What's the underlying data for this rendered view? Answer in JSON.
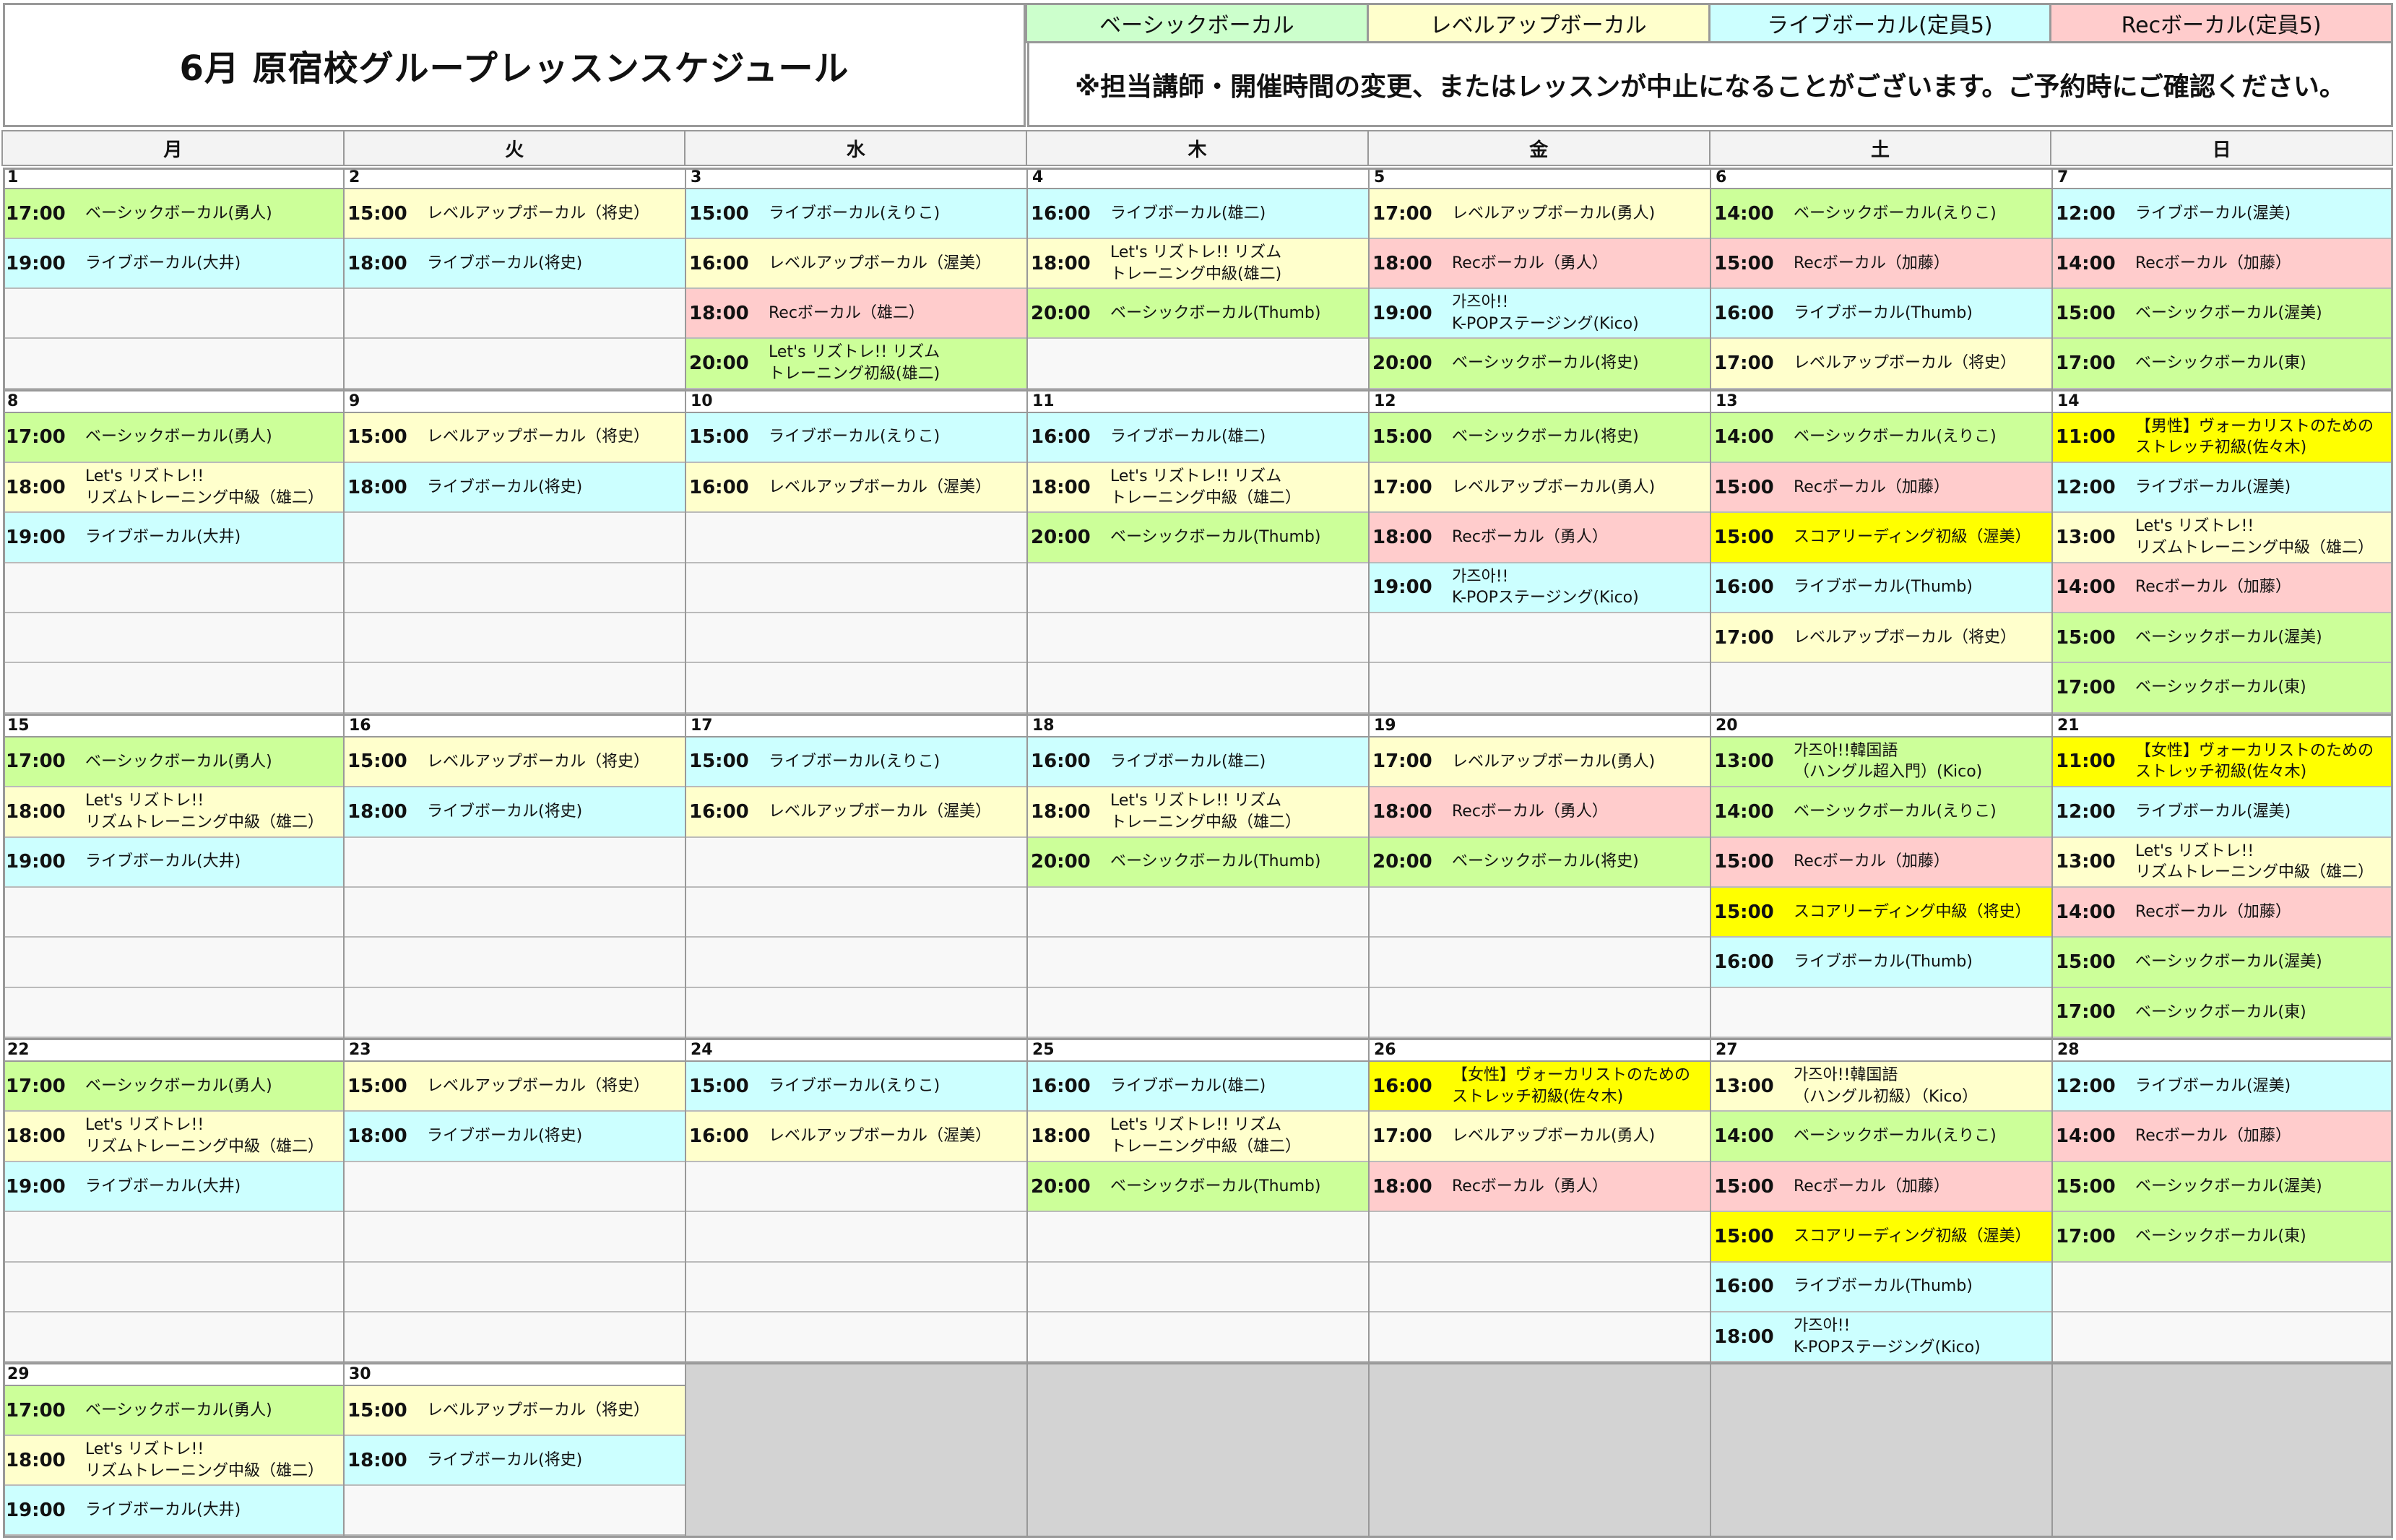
{
  "header": {
    "title": "6月 原宿校グループレッスンスケジュール",
    "notice": "※担当講師・開催時間の変更、またはレッスンが中止になることがございます。ご予約時にご確認ください。"
  },
  "legend": [
    {
      "label": "ベーシックボーカル",
      "color": "#ccffcc"
    },
    {
      "label": "レベルアップボーカル",
      "color": "#ffffcc"
    },
    {
      "label": "ライブボーカル(定員5)",
      "color": "#ccffff"
    },
    {
      "label": "Recボーカル(定員5)",
      "color": "#ffcccc"
    }
  ],
  "colors": {
    "basic": "#ccff99",
    "levelup": "#ffffcc",
    "live": "#ccffff",
    "rec": "#ffcccc",
    "special": "#ffff00",
    "empty": "#f8f8f8",
    "grey": "#d3d3d3"
  },
  "weekdays": [
    "月",
    "火",
    "水",
    "木",
    "金",
    "土",
    "日"
  ],
  "weeks": [
    {
      "slots": 4,
      "days": [
        {
          "date": "1",
          "lessons": [
            {
              "time": "17:00",
              "label": "ベーシックボーカル(勇人)",
              "type": "basic"
            },
            {
              "time": "19:00",
              "label": "ライブボーカル(大井)",
              "type": "live"
            }
          ]
        },
        {
          "date": "2",
          "lessons": [
            {
              "time": "15:00",
              "label": "レベルアップボーカル（将史）",
              "type": "levelup"
            },
            {
              "time": "18:00",
              "label": "ライブボーカル(将史)",
              "type": "live"
            }
          ]
        },
        {
          "date": "3",
          "lessons": [
            {
              "time": "15:00",
              "label": "ライブボーカル(えりこ)",
              "type": "live"
            },
            {
              "time": "16:00",
              "label": "レベルアップボーカル（渥美）",
              "type": "levelup"
            },
            {
              "time": "18:00",
              "label": "Recボーカル（雄二）",
              "type": "rec"
            },
            {
              "time": "20:00",
              "label": "Let's リズトレ!! リズム\nトレーニング初級(雄二)",
              "type": "basic"
            }
          ]
        },
        {
          "date": "4",
          "lessons": [
            {
              "time": "16:00",
              "label": "ライブボーカル(雄二)",
              "type": "live"
            },
            {
              "time": "18:00",
              "label": "Let's リズトレ!! リズム\nトレーニング中級(雄二)",
              "type": "levelup"
            },
            {
              "time": "20:00",
              "label": "ベーシックボーカル(Thumb)",
              "type": "basic"
            }
          ]
        },
        {
          "date": "5",
          "lessons": [
            {
              "time": "17:00",
              "label": "レベルアップボーカル(勇人)",
              "type": "levelup"
            },
            {
              "time": "18:00",
              "label": "Recボーカル（勇人）",
              "type": "rec"
            },
            {
              "time": "19:00",
              "label": "가즈아!!\nK-POPステージング(Kico)",
              "type": "live"
            },
            {
              "time": "20:00",
              "label": "ベーシックボーカル(将史)",
              "type": "basic"
            }
          ]
        },
        {
          "date": "6",
          "lessons": [
            {
              "time": "14:00",
              "label": "ベーシックボーカル(えりこ)",
              "type": "basic"
            },
            {
              "time": "15:00",
              "label": "Recボーカル（加藤）",
              "type": "rec"
            },
            {
              "time": "16:00",
              "label": "ライブボーカル(Thumb)",
              "type": "live"
            },
            {
              "time": "17:00",
              "label": "レベルアップボーカル（将史）",
              "type": "levelup"
            }
          ]
        },
        {
          "date": "7",
          "lessons": [
            {
              "time": "12:00",
              "label": "ライブボーカル(渥美)",
              "type": "live"
            },
            {
              "time": "14:00",
              "label": "Recボーカル（加藤）",
              "type": "rec"
            },
            {
              "time": "15:00",
              "label": "ベーシックボーカル(渥美)",
              "type": "basic"
            },
            {
              "time": "17:00",
              "label": "ベーシックボーカル(東)",
              "type": "basic"
            }
          ]
        }
      ]
    },
    {
      "slots": 6,
      "days": [
        {
          "date": "8",
          "lessons": [
            {
              "time": "17:00",
              "label": "ベーシックボーカル(勇人)",
              "type": "basic"
            },
            {
              "time": "18:00",
              "label": "Let's リズトレ!!\nリズムトレーニング中級（雄二）",
              "type": "levelup"
            },
            {
              "time": "19:00",
              "label": "ライブボーカル(大井)",
              "type": "live"
            }
          ]
        },
        {
          "date": "9",
          "lessons": [
            {
              "time": "15:00",
              "label": "レベルアップボーカル（将史）",
              "type": "levelup"
            },
            {
              "time": "18:00",
              "label": "ライブボーカル(将史)",
              "type": "live"
            }
          ]
        },
        {
          "date": "10",
          "lessons": [
            {
              "time": "15:00",
              "label": "ライブボーカル(えりこ)",
              "type": "live"
            },
            {
              "time": "16:00",
              "label": "レベルアップボーカル（渥美）",
              "type": "levelup"
            }
          ]
        },
        {
          "date": "11",
          "lessons": [
            {
              "time": "16:00",
              "label": "ライブボーカル(雄二)",
              "type": "live"
            },
            {
              "time": "18:00",
              "label": "Let's リズトレ!! リズム\nトレーニング中級（雄二）",
              "type": "levelup"
            },
            {
              "time": "20:00",
              "label": "ベーシックボーカル(Thumb)",
              "type": "basic"
            }
          ]
        },
        {
          "date": "12",
          "lessons": [
            {
              "time": "15:00",
              "label": "ベーシックボーカル(将史)",
              "type": "basic"
            },
            {
              "time": "17:00",
              "label": "レベルアップボーカル(勇人)",
              "type": "levelup"
            },
            {
              "time": "18:00",
              "label": "Recボーカル（勇人）",
              "type": "rec"
            },
            {
              "time": "19:00",
              "label": "가즈아!!\nK-POPステージング(Kico)",
              "type": "live"
            }
          ]
        },
        {
          "date": "13",
          "lessons": [
            {
              "time": "14:00",
              "label": "ベーシックボーカル(えりこ)",
              "type": "basic"
            },
            {
              "time": "15:00",
              "label": "Recボーカル（加藤）",
              "type": "rec"
            },
            {
              "time": "15:00",
              "label": "スコアリーディング初級（渥美）",
              "type": "special"
            },
            {
              "time": "16:00",
              "label": "ライブボーカル(Thumb)",
              "type": "live"
            },
            {
              "time": "17:00",
              "label": "レベルアップボーカル（将史）",
              "type": "levelup"
            }
          ]
        },
        {
          "date": "14",
          "lessons": [
            {
              "time": "11:00",
              "label": "【男性】ヴォーカリストのための\nストレッチ初級(佐々木)",
              "type": "special"
            },
            {
              "time": "12:00",
              "label": "ライブボーカル(渥美)",
              "type": "live"
            },
            {
              "time": "13:00",
              "label": "Let's リズトレ!!\nリズムトレーニング中級（雄二）",
              "type": "levelup"
            },
            {
              "time": "14:00",
              "label": "Recボーカル（加藤）",
              "type": "rec"
            },
            {
              "time": "15:00",
              "label": "ベーシックボーカル(渥美)",
              "type": "basic"
            },
            {
              "time": "17:00",
              "label": "ベーシックボーカル(東)",
              "type": "basic"
            }
          ]
        }
      ]
    },
    {
      "slots": 6,
      "days": [
        {
          "date": "15",
          "lessons": [
            {
              "time": "17:00",
              "label": "ベーシックボーカル(勇人)",
              "type": "basic"
            },
            {
              "time": "18:00",
              "label": "Let's リズトレ!!\nリズムトレーニング中級（雄二）",
              "type": "levelup"
            },
            {
              "time": "19:00",
              "label": "ライブボーカル(大井)",
              "type": "live"
            }
          ]
        },
        {
          "date": "16",
          "lessons": [
            {
              "time": "15:00",
              "label": "レベルアップボーカル（将史）",
              "type": "levelup"
            },
            {
              "time": "18:00",
              "label": "ライブボーカル(将史)",
              "type": "live"
            }
          ]
        },
        {
          "date": "17",
          "lessons": [
            {
              "time": "15:00",
              "label": "ライブボーカル(えりこ)",
              "type": "live"
            },
            {
              "time": "16:00",
              "label": "レベルアップボーカル（渥美）",
              "type": "levelup"
            }
          ]
        },
        {
          "date": "18",
          "lessons": [
            {
              "time": "16:00",
              "label": "ライブボーカル(雄二)",
              "type": "live"
            },
            {
              "time": "18:00",
              "label": "Let's リズトレ!! リズム\nトレーニング中級（雄二）",
              "type": "levelup"
            },
            {
              "time": "20:00",
              "label": "ベーシックボーカル(Thumb)",
              "type": "basic"
            }
          ]
        },
        {
          "date": "19",
          "lessons": [
            {
              "time": "17:00",
              "label": "レベルアップボーカル(勇人)",
              "type": "levelup"
            },
            {
              "time": "18:00",
              "label": "Recボーカル（勇人）",
              "type": "rec"
            },
            {
              "time": "20:00",
              "label": "ベーシックボーカル(将史)",
              "type": "basic"
            }
          ]
        },
        {
          "date": "20",
          "lessons": [
            {
              "time": "13:00",
              "label": "가즈아!!韓国語\n（ハングル超入門）(Kico)",
              "type": "basic"
            },
            {
              "time": "14:00",
              "label": "ベーシックボーカル(えりこ)",
              "type": "basic"
            },
            {
              "time": "15:00",
              "label": "Recボーカル（加藤）",
              "type": "rec"
            },
            {
              "time": "15:00",
              "label": "スコアリーディング中級（将史）",
              "type": "special"
            },
            {
              "time": "16:00",
              "label": "ライブボーカル(Thumb)",
              "type": "live"
            }
          ]
        },
        {
          "date": "21",
          "lessons": [
            {
              "time": "11:00",
              "label": "【女性】ヴォーカリストのための\nストレッチ初級(佐々木)",
              "type": "special"
            },
            {
              "time": "12:00",
              "label": "ライブボーカル(渥美)",
              "type": "live"
            },
            {
              "time": "13:00",
              "label": "Let's リズトレ!!\nリズムトレーニング中級（雄二）",
              "type": "levelup"
            },
            {
              "time": "14:00",
              "label": "Recボーカル（加藤）",
              "type": "rec"
            },
            {
              "time": "15:00",
              "label": "ベーシックボーカル(渥美)",
              "type": "basic"
            },
            {
              "time": "17:00",
              "label": "ベーシックボーカル(東)",
              "type": "basic"
            }
          ]
        }
      ]
    },
    {
      "slots": 6,
      "days": [
        {
          "date": "22",
          "lessons": [
            {
              "time": "17:00",
              "label": "ベーシックボーカル(勇人)",
              "type": "basic"
            },
            {
              "time": "18:00",
              "label": "Let's リズトレ!!\nリズムトレーニング中級（雄二）",
              "type": "levelup"
            },
            {
              "time": "19:00",
              "label": "ライブボーカル(大井)",
              "type": "live"
            }
          ]
        },
        {
          "date": "23",
          "lessons": [
            {
              "time": "15:00",
              "label": "レベルアップボーカル（将史）",
              "type": "levelup"
            },
            {
              "time": "18:00",
              "label": "ライブボーカル(将史)",
              "type": "live"
            }
          ]
        },
        {
          "date": "24",
          "lessons": [
            {
              "time": "15:00",
              "label": "ライブボーカル(えりこ)",
              "type": "live"
            },
            {
              "time": "16:00",
              "label": "レベルアップボーカル（渥美）",
              "type": "levelup"
            }
          ]
        },
        {
          "date": "25",
          "lessons": [
            {
              "time": "16:00",
              "label": "ライブボーカル(雄二)",
              "type": "live"
            },
            {
              "time": "18:00",
              "label": "Let's リズトレ!! リズム\nトレーニング中級（雄二）",
              "type": "levelup"
            },
            {
              "time": "20:00",
              "label": "ベーシックボーカル(Thumb)",
              "type": "basic"
            }
          ]
        },
        {
          "date": "26",
          "lessons": [
            {
              "time": "16:00",
              "label": "【女性】ヴォーカリストのための\nストレッチ初級(佐々木)",
              "type": "special"
            },
            {
              "time": "17:00",
              "label": "レベルアップボーカル(勇人)",
              "type": "levelup"
            },
            {
              "time": "18:00",
              "label": "Recボーカル（勇人）",
              "type": "rec"
            }
          ]
        },
        {
          "date": "27",
          "lessons": [
            {
              "time": "13:00",
              "label": "가즈아!!韓国語\n（ハングル初級）（Kico）",
              "type": "levelup"
            },
            {
              "time": "14:00",
              "label": "ベーシックボーカル(えりこ)",
              "type": "basic"
            },
            {
              "time": "15:00",
              "label": "Recボーカル（加藤）",
              "type": "rec"
            },
            {
              "time": "15:00",
              "label": "スコアリーディング初級（渥美）",
              "type": "special"
            },
            {
              "time": "16:00",
              "label": "ライブボーカル(Thumb)",
              "type": "live"
            },
            {
              "time": "18:00",
              "label": "가즈아!!\nK-POPステージング(Kico)",
              "type": "live"
            }
          ]
        },
        {
          "date": "28",
          "lessons": [
            {
              "time": "12:00",
              "label": "ライブボーカル(渥美)",
              "type": "live"
            },
            {
              "time": "14:00",
              "label": "Recボーカル（加藤）",
              "type": "rec"
            },
            {
              "time": "15:00",
              "label": "ベーシックボーカル(渥美)",
              "type": "basic"
            },
            {
              "time": "17:00",
              "label": "ベーシックボーカル(東)",
              "type": "basic"
            }
          ]
        }
      ]
    },
    {
      "slots": 3,
      "days": [
        {
          "date": "29",
          "lessons": [
            {
              "time": "17:00",
              "label": "ベーシックボーカル(勇人)",
              "type": "basic"
            },
            {
              "time": "18:00",
              "label": "Let's リズトレ!!\nリズムトレーニング中級（雄二）",
              "type": "levelup"
            },
            {
              "time": "19:00",
              "label": "ライブボーカル(大井)",
              "type": "live"
            }
          ]
        },
        {
          "date": "30",
          "lessons": [
            {
              "time": "15:00",
              "label": "レベルアップボーカル（将史）",
              "type": "levelup"
            },
            {
              "time": "18:00",
              "label": "ライブボーカル(将史)",
              "type": "live"
            }
          ]
        },
        {
          "date": "",
          "grey": true,
          "lessons": []
        },
        {
          "date": "",
          "grey": true,
          "lessons": []
        },
        {
          "date": "",
          "grey": true,
          "lessons": []
        },
        {
          "date": "",
          "grey": true,
          "lessons": []
        },
        {
          "date": "",
          "grey": true,
          "lessons": []
        }
      ]
    }
  ]
}
